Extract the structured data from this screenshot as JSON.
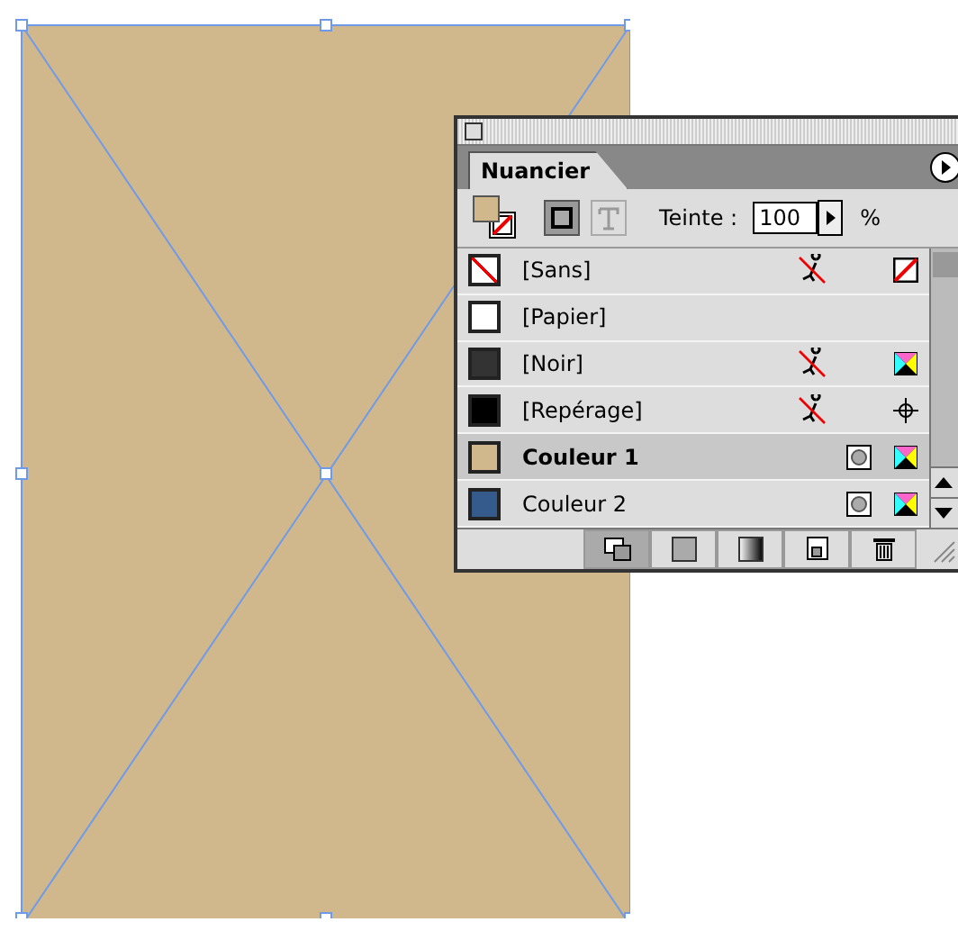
{
  "panel": {
    "tab": {
      "label": "Nuancier",
      "selected": true
    },
    "tint": {
      "label": "Teinte :",
      "value": "100",
      "unit": "%"
    },
    "swatches": [
      {
        "name": "[Sans]",
        "kind": "none",
        "color": "#ffffff",
        "selected": false,
        "not_editable": true,
        "process": false
      },
      {
        "name": "[Papier]",
        "kind": "paper",
        "color": "#ffffff",
        "selected": false,
        "not_editable": false,
        "process": false
      },
      {
        "name": "[Noir]",
        "kind": "cmyk",
        "color": "#333333",
        "selected": false,
        "not_editable": true,
        "process": false
      },
      {
        "name": "[Repérage]",
        "kind": "registration",
        "color": "#000000",
        "selected": false,
        "not_editable": true,
        "process": false
      },
      {
        "name": "Couleur 1",
        "kind": "cmyk",
        "color": "#d1b88c",
        "selected": true,
        "not_editable": false,
        "process": true
      },
      {
        "name": "Couleur 2",
        "kind": "cmyk",
        "color": "#355a8c",
        "selected": false,
        "not_editable": false,
        "process": true
      }
    ]
  }
}
